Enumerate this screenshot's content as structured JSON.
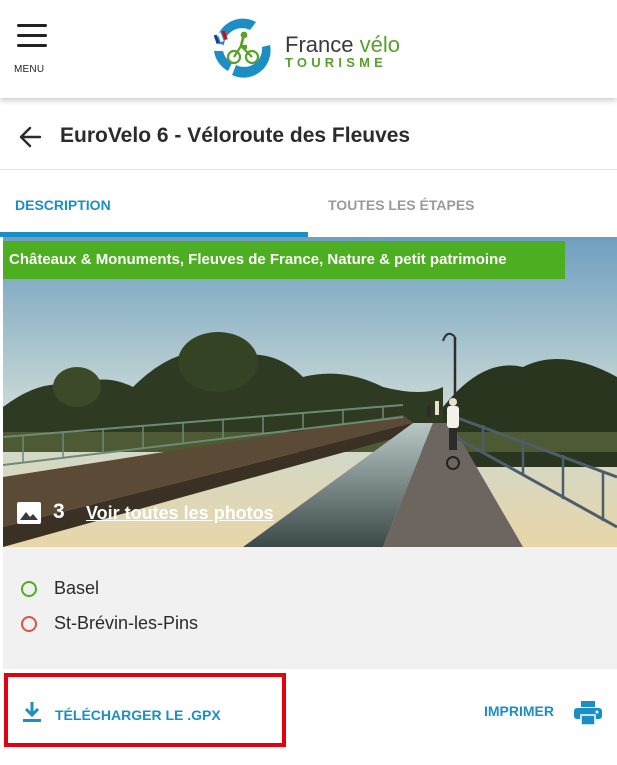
{
  "header": {
    "menu_label": "MENU",
    "logo_text_line1": "France",
    "logo_text_velo": "vélo",
    "logo_text_line2": "TOURISME"
  },
  "title_bar": {
    "title": "EuroVelo 6 - Véloroute des Fleuves"
  },
  "tabs": [
    {
      "label": "DESCRIPTION",
      "active": true
    },
    {
      "label": "TOUTES LES ÉTAPES",
      "active": false
    }
  ],
  "hero": {
    "tags": "Châteaux & Monuments, Fleuves de France, Nature & petit patrimoine",
    "photo_count": "3",
    "photo_link": "Voir toutes les photos"
  },
  "route": {
    "start": "Basel",
    "end": "St-Brévin-les-Pins"
  },
  "actions": {
    "download_label": "TÉLÉCHARGER LE .GPX",
    "print_label": "IMPRIMER"
  },
  "colors": {
    "accent_blue": "#1b8fc4",
    "tag_green": "#4cae20",
    "start_green": "#4cae20",
    "end_red": "#d9534f",
    "highlight_red": "#e3000f"
  },
  "icons": [
    "menu-icon",
    "back-arrow-icon",
    "image-icon",
    "download-icon",
    "printer-icon"
  ]
}
